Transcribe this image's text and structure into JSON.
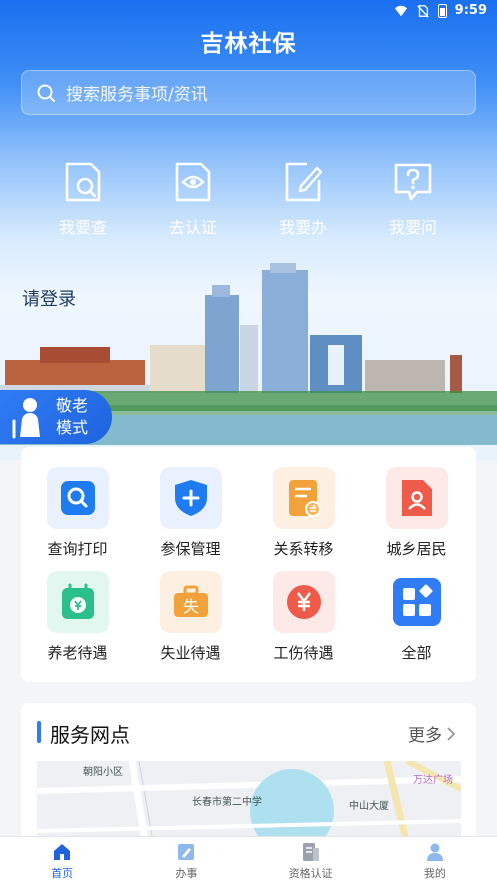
{
  "status_bar": {
    "time": "9:59"
  },
  "app": {
    "title": "吉林社保"
  },
  "search": {
    "placeholder": "搜索服务事项/资讯"
  },
  "quick_actions": [
    {
      "label": "我要查",
      "icon": "search-document-icon"
    },
    {
      "label": "去认证",
      "icon": "eye-document-icon"
    },
    {
      "label": "我要办",
      "icon": "edit-document-icon"
    },
    {
      "label": "我要问",
      "icon": "question-bubble-icon"
    }
  ],
  "login": {
    "label": "请登录"
  },
  "elder_mode": {
    "label": "敬老模式"
  },
  "services": [
    {
      "label": "查询打印",
      "icon": "search-icon",
      "color": "#1f7cf0"
    },
    {
      "label": "参保管理",
      "icon": "shield-plus-icon",
      "color": "#1f7cf0"
    },
    {
      "label": "关系转移",
      "icon": "transfer-document-icon",
      "color": "#f2a23a"
    },
    {
      "label": "城乡居民",
      "icon": "person-document-icon",
      "color": "#ef5b4a"
    },
    {
      "label": "养老待遇",
      "icon": "calendar-yuan-icon",
      "color": "#2bbf8a"
    },
    {
      "label": "失业待遇",
      "icon": "briefcase-icon",
      "color": "#f2a23a"
    },
    {
      "label": "工伤待遇",
      "icon": "yuan-circle-icon",
      "color": "#ef5b4a"
    },
    {
      "label": "全部",
      "icon": "grid-icon",
      "color": "#2f7cf4"
    }
  ],
  "network": {
    "title": "服务网点",
    "more": "更多",
    "map_labels": [
      "朝阳小区",
      "长春市第二中学",
      "万达广场",
      "中山大厦"
    ]
  },
  "tabs": [
    {
      "label": "首页",
      "icon": "home-icon",
      "active": true
    },
    {
      "label": "办事",
      "icon": "edit-icon",
      "active": false
    },
    {
      "label": "资格认证",
      "icon": "id-card-icon",
      "active": false
    },
    {
      "label": "我的",
      "icon": "user-icon",
      "active": false
    }
  ]
}
